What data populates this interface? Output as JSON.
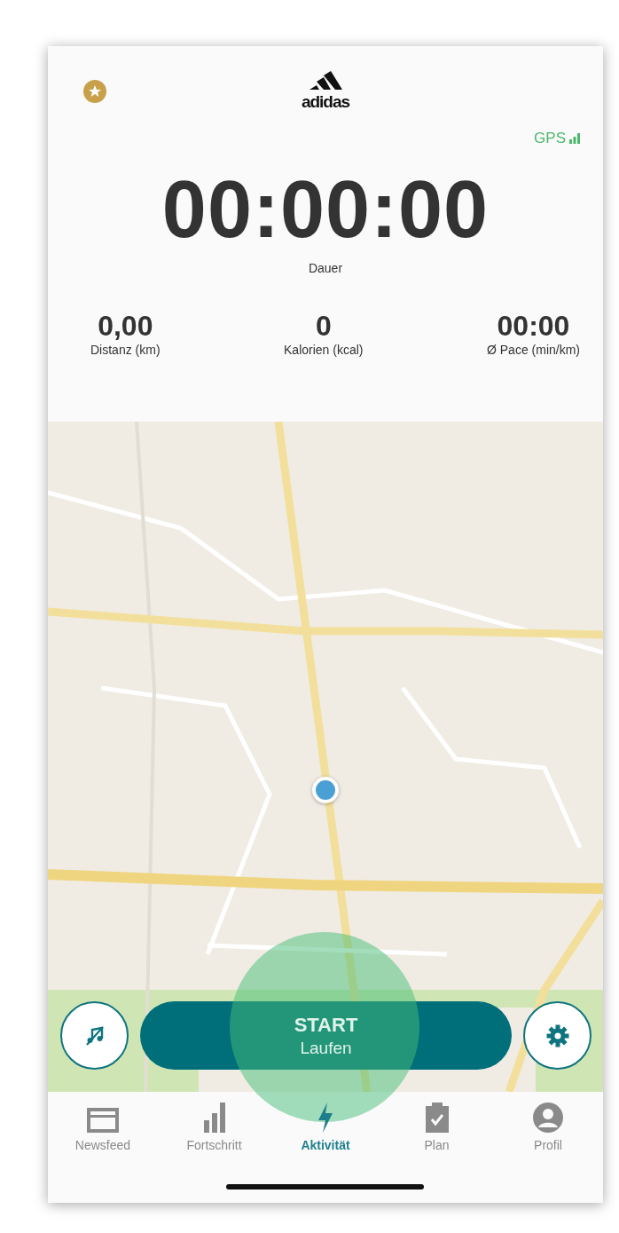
{
  "header": {
    "logo": "adidas",
    "gps": "GPS"
  },
  "timer": {
    "value": "00:00:00",
    "label": "Dauer"
  },
  "stats": [
    {
      "value": "0,00",
      "label": "Distanz (km)"
    },
    {
      "value": "0",
      "label": "Kalorien (kcal)"
    },
    {
      "value": "00:00",
      "label": "Ø Pace (min/km)"
    }
  ],
  "controls": {
    "music_muted": true,
    "start": {
      "title": "START",
      "subtitle": "Laufen"
    }
  },
  "tabs": [
    {
      "label": "Newsfeed",
      "selected": false
    },
    {
      "label": "Fortschritt",
      "selected": false
    },
    {
      "label": "Aktivität",
      "selected": true
    },
    {
      "label": "Plan",
      "selected": false
    },
    {
      "label": "Profil",
      "selected": false
    }
  ]
}
